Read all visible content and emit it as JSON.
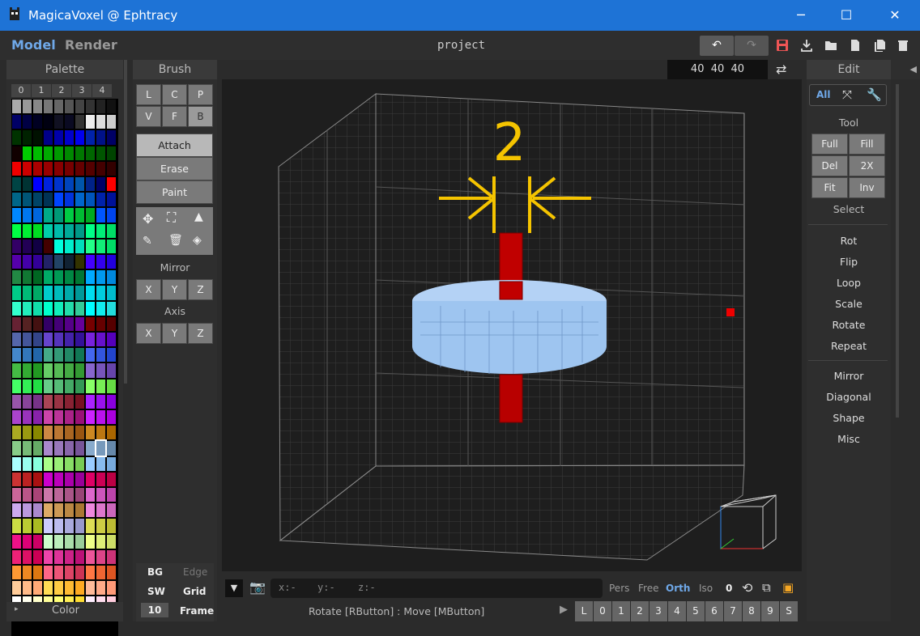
{
  "window": {
    "title": "MagicaVoxel @ Ephtracy",
    "minimize": "─",
    "maximize": "☐",
    "close": "✕"
  },
  "menubar": {
    "model_tab": "Model",
    "render_tab": "Render",
    "project_name": "project"
  },
  "toolbar": {
    "undo": "↶",
    "redo": "↷"
  },
  "palette": {
    "header": "Palette",
    "tabs": [
      "0",
      "1",
      "2",
      "3",
      "4"
    ],
    "footer_label": "Color",
    "colors": [
      [
        "#aaaaaa",
        "#999999",
        "#888888",
        "#777777",
        "#666666",
        "#555555",
        "#444444",
        "#333333",
        "#222222",
        "#111111",
        "#0a0a0a"
      ],
      [
        "#000066",
        "#000044",
        "#000022",
        "#000011",
        "#111122",
        "#0a0a22",
        "#333333",
        "#eeeeee",
        "#dddddd",
        "#cccccc"
      ],
      [
        "#003300",
        "#002200",
        "#001100",
        "#000088",
        "#0000aa",
        "#0000cc",
        "#0000ee",
        "#0022aa",
        "#001188",
        "#000066"
      ],
      [
        "#110000",
        "#00cc00",
        "#00bb00",
        "#00aa00",
        "#009900",
        "#008800",
        "#007700",
        "#006600",
        "#005500",
        "#004400"
      ],
      [
        "#ee0000",
        "#cc0000",
        "#aa0000",
        "#990000",
        "#880000",
        "#770000",
        "#660000",
        "#550000",
        "#440000",
        "#330000"
      ],
      [
        "#004444",
        "#003333",
        "#0000ff",
        "#0022dd",
        "#0033cc",
        "#0044bb",
        "#0055aa",
        "#002288",
        "#000066",
        "#ff0000"
      ],
      [
        "#006688",
        "#005577",
        "#004466",
        "#003355",
        "#0044ff",
        "#0033dd",
        "#0066cc",
        "#0055bb",
        "#0022aa",
        "#001199"
      ],
      [
        "#0088ff",
        "#0077ee",
        "#0066dd",
        "#00aa88",
        "#009977",
        "#00cc44",
        "#00bb33",
        "#00aa22",
        "#0055ff",
        "#0044ee"
      ],
      [
        "#00ff44",
        "#00ee33",
        "#00dd22",
        "#00ccaa",
        "#00bbaa",
        "#00aa99",
        "#009988",
        "#00ff88",
        "#00ee77",
        "#00dd66"
      ],
      [
        "#330066",
        "#220055",
        "#110044",
        "#440000",
        "#00ffdd",
        "#00eecc",
        "#00ddbb",
        "#22ff88",
        "#11ee77",
        "#00dd66"
      ],
      [
        "#5500aa",
        "#4400aa",
        "#330099",
        "#222266",
        "#224466",
        "#112233",
        "#333300",
        "#4400ff",
        "#3300ee",
        "#2200dd"
      ],
      [
        "#228844",
        "#117733",
        "#006622",
        "#00aa66",
        "#009955",
        "#008844",
        "#007733",
        "#00aaff",
        "#0099ee",
        "#0088dd"
      ],
      [
        "#00cc88",
        "#00bb77",
        "#00aa66",
        "#00cccc",
        "#00bbbb",
        "#00aaaa",
        "#009999",
        "#00ddee",
        "#00ccdd",
        "#00bbcc"
      ],
      [
        "#33ffcc",
        "#22eebb",
        "#11ddaa",
        "#00ffcc",
        "#11eebb",
        "#22ddaa",
        "#33cc99",
        "#00ffff",
        "#11eeee",
        "#22dddd"
      ],
      [
        "#662233",
        "#552222",
        "#441111",
        "#330066",
        "#440077",
        "#550088",
        "#660099",
        "#770000",
        "#660000",
        "#550000"
      ],
      [
        "#5566aa",
        "#445599",
        "#334488",
        "#6644cc",
        "#5533bb",
        "#4422aa",
        "#331199",
        "#7722dd",
        "#6611cc",
        "#5500bb"
      ],
      [
        "#4488cc",
        "#3377bb",
        "#2266aa",
        "#44aa88",
        "#339977",
        "#228866",
        "#117755",
        "#4466ee",
        "#3355dd",
        "#2244cc"
      ],
      [
        "#44bb44",
        "#33aa33",
        "#229922",
        "#66cc66",
        "#55bb55",
        "#44aa44",
        "#339933",
        "#8866cc",
        "#7755bb",
        "#6644aa"
      ],
      [
        "#44ff66",
        "#33ee55",
        "#22dd44",
        "#66cc88",
        "#55bb77",
        "#44aa66",
        "#339955",
        "#88ff66",
        "#77ee55",
        "#66dd44"
      ],
      [
        "#9955aa",
        "#884499",
        "#773388",
        "#aa4455",
        "#993344",
        "#882233",
        "#771122",
        "#aa22ff",
        "#9911ee",
        "#8800dd"
      ],
      [
        "#aa44cc",
        "#9933bb",
        "#8822aa",
        "#cc44aa",
        "#bb3399",
        "#aa2288",
        "#991177",
        "#cc22ff",
        "#bb11ee",
        "#aa00dd"
      ],
      [
        "#aaaa22",
        "#999911",
        "#888800",
        "#cc8844",
        "#bb7733",
        "#aa6622",
        "#995511",
        "#cc8822",
        "#bb7711",
        "#aa6600"
      ],
      [
        "#88cc88",
        "#77bb77",
        "#66aa66",
        "#aa88cc",
        "#9977bb",
        "#8866aa",
        "#775599",
        "#88aacc",
        "#7799bb",
        "#6688aa"
      ],
      [
        "#aaffff",
        "#99ffee",
        "#88ffdd",
        "#aaff88",
        "#99ee77",
        "#88dd66",
        "#77cc55",
        "#99ccff",
        "#88bbee",
        "#77aadd"
      ],
      [
        "#cc3333",
        "#bb2222",
        "#aa1111",
        "#cc00cc",
        "#bb00bb",
        "#aa00aa",
        "#990099",
        "#dd0066",
        "#cc0055",
        "#bb0044"
      ],
      [
        "#cc6699",
        "#bb5588",
        "#aa4477",
        "#cc77aa",
        "#bb6699",
        "#aa5588",
        "#994477",
        "#dd66cc",
        "#cc55bb",
        "#bb44aa"
      ],
      [
        "#ccaaee",
        "#bb99dd",
        "#aa88cc",
        "#ddaa66",
        "#cc9955",
        "#bb8844",
        "#aa7733",
        "#ee88dd",
        "#dd77cc",
        "#cc66bb"
      ],
      [
        "#ccdd44",
        "#bbcc33",
        "#aabb22",
        "#ccccff",
        "#bbbbee",
        "#aaaadd",
        "#9999cc",
        "#dddd55",
        "#cccc44",
        "#bbbb33"
      ],
      [
        "#ee1188",
        "#dd0077",
        "#cc0066",
        "#ccffcc",
        "#bbeebb",
        "#aaddaa",
        "#99cc99",
        "#eeff88",
        "#ddee77",
        "#ccdd66"
      ],
      [
        "#ee2277",
        "#dd1166",
        "#cc0055",
        "#ee44aa",
        "#dd3399",
        "#cc2288",
        "#bb1177",
        "#ee5599",
        "#dd4488",
        "#cc3377"
      ],
      [
        "#ff9933",
        "#ee8822",
        "#dd7711",
        "#ff6688",
        "#ee5577",
        "#dd4466",
        "#cc3355",
        "#ff7744",
        "#ee6633",
        "#dd5522"
      ],
      [
        "#ffcc99",
        "#ffbb88",
        "#ffaa77",
        "#ffdd55",
        "#ffcc44",
        "#ffbb33",
        "#ffaa22",
        "#ffbb99",
        "#ffaa88",
        "#ff9977"
      ],
      [
        "#ffffff",
        "#ffffee",
        "#ffffcc",
        "#ffff99",
        "#ffff77",
        "#ffee55",
        "#ffdd33",
        "#ffeeff",
        "#ffddee",
        "#ffccdd"
      ]
    ]
  },
  "brush": {
    "header": "Brush",
    "row1": [
      "L",
      "C",
      "P"
    ],
    "row2": [
      "V",
      "F",
      "B"
    ],
    "modes": [
      "Attach",
      "Erase",
      "Paint"
    ],
    "mirror_label": "Mirror",
    "mirror": [
      "X",
      "Y",
      "Z"
    ],
    "axis_label": "Axis",
    "axis": [
      "X",
      "Y",
      "Z"
    ],
    "bg": "BG",
    "edge": "Edge",
    "sw": "SW",
    "grid": "Grid",
    "frame_count": "10",
    "frame": "Frame"
  },
  "viewport": {
    "size_readout": "40  40  40",
    "annotation_number": "2",
    "coords": {
      "x": "x:-",
      "y": "y:-",
      "z": "z:-"
    },
    "status": "Rotate [RButton] : Move [MButton]",
    "views": [
      "Pers",
      "Free",
      "Orth",
      "Iso"
    ],
    "active_view": "Orth",
    "zero": "0",
    "frames": [
      "L",
      "0",
      "1",
      "2",
      "3",
      "4",
      "5",
      "6",
      "7",
      "8",
      "9",
      "S"
    ]
  },
  "edit": {
    "header": "Edit",
    "tabs": [
      "All"
    ],
    "tool_label": "Tool",
    "tool_grid": [
      [
        "Full",
        "Fill"
      ],
      [
        "Del",
        "2X"
      ],
      [
        "Fit",
        "Inv"
      ]
    ],
    "select": "Select",
    "group1": [
      "Rot",
      "Flip",
      "Loop",
      "Scale",
      "Rotate",
      "Repeat"
    ],
    "group2": [
      "Mirror",
      "Diagonal",
      "Shape",
      "Misc"
    ]
  },
  "colors": {
    "titlebar": "#1e73d6",
    "accent": "#6fa8e8",
    "annotation": "#f5c400",
    "voxel_blue": "#9ec5f0",
    "voxel_red": "#cc0000"
  }
}
